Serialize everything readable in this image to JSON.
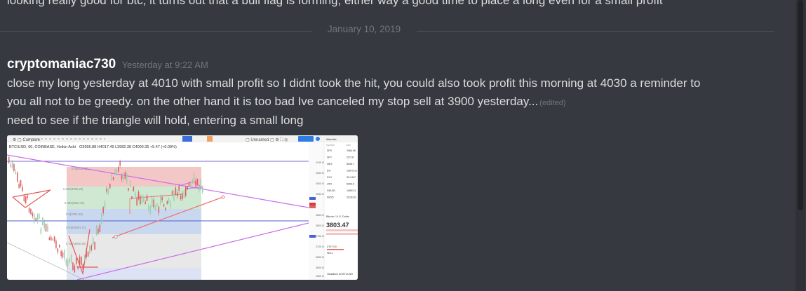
{
  "previous_message": {
    "text": "looking really good for btc, it turns out that a bull flag is forming, either way a good time to place a long even for a small profit"
  },
  "date_divider": {
    "label": "January 10, 2019"
  },
  "message": {
    "username": "cryptomaniac730",
    "timestamp": "Yesterday at 9:22 AM",
    "line1": "close my long yesterday at 4010 with small profit so I didnt took the hit, you could also took profit this morning at 4030 a reminder to",
    "line2": "you all not to be greedy. on the other hand it is  too bad Ive canceled my stop sell at 3900 yesterday...",
    "edited_label": "(edited)",
    "line3": "need to see if the triangle will hold, entering a small long"
  },
  "chart_screenshot": {
    "symbol_line": "BTC/USD, 60, COINBASE, Heikin Ashi",
    "ohlc_line": "O3996.88 H4017.49 L3982.38 C4000.35 +5.47 (+0.09%)",
    "watchlist": {
      "title": "Watchlist",
      "columns": [
        "Symbol",
        "Last"
      ],
      "rows": [
        {
          "symbol": "SPX",
          "last": "2584.96"
        },
        {
          "symbol": "SPY",
          "last": "257.97"
        },
        {
          "symbol": "NDX",
          "last": "6638.7"
        },
        {
          "symbol": "DJI",
          "last": "23879.12"
        },
        {
          "symbol": "DXY",
          "last": "95.1447"
        },
        {
          "symbol": "UKX",
          "last": "6906.6"
        },
        {
          "symbol": "DEU30",
          "last": "10893.3"
        },
        {
          "symbol": "NI225",
          "last": "20163.8"
        }
      ],
      "details_title": "Bitcoin / U.S. Dollar",
      "price": "3803.47",
      "sell_price": "3797.00",
      "sell_label": "SELL",
      "headlines": "Headlines for BTCUSD"
    },
    "fib_levels": [
      "0.236(3996.28)",
      "0.382(3891.61)",
      "0.5(3791.53)",
      "0.618(3691.71)",
      "0.786(3550.28)"
    ],
    "colors": {
      "up_candle": "#9ad0b0",
      "down_candle": "#e05a5a",
      "triangle_line": "#c86ee8",
      "fib_band_red": "#f4c7c7",
      "fib_band_green": "#cfe8d2",
      "fib_band_blue": "#c9d8ee"
    }
  }
}
